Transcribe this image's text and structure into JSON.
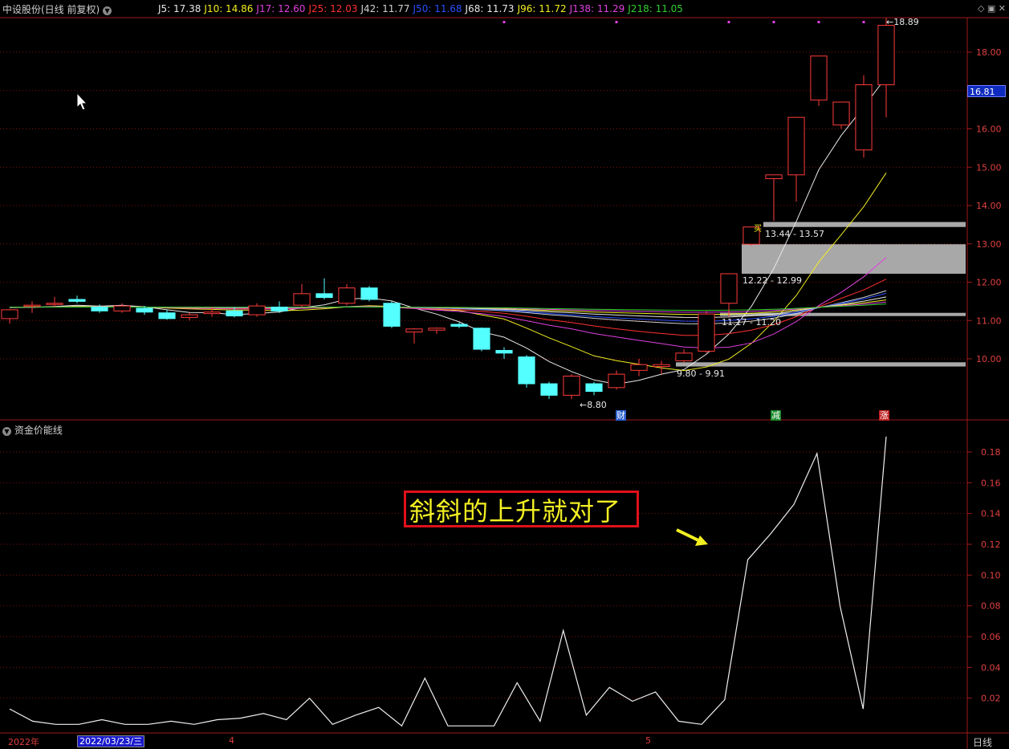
{
  "header": {
    "title": "中设股份(日线 前复权)",
    "ma_legend": [
      {
        "label": "J5: 17.38",
        "color": "#e8e8e8"
      },
      {
        "label": "J10: 14.86",
        "color": "#f2ef22"
      },
      {
        "label": "J17: 12.60",
        "color": "#e040e0"
      },
      {
        "label": "J25: 12.03",
        "color": "#ff3030"
      },
      {
        "label": "J42: 11.77",
        "color": "#d0d0d0"
      },
      {
        "label": "J50: 11.68",
        "color": "#2850ff"
      },
      {
        "label": "J68: 11.73",
        "color": "#e8e8e8"
      },
      {
        "label": "J96: 11.72",
        "color": "#f2ef22"
      },
      {
        "label": "J138: 11.29",
        "color": "#e040e0"
      },
      {
        "label": "J218: 11.05",
        "color": "#30d030"
      }
    ],
    "window_icons": "◇ ▣ ✕"
  },
  "price_axis": {
    "ticks": [
      "18.00",
      "17.00",
      "16.00",
      "15.00",
      "14.00",
      "13.00",
      "12.00",
      "11.00",
      "10.00"
    ],
    "current_price": "16.81"
  },
  "price_labels": {
    "high": "18.89",
    "low": "8.80",
    "zone1": "13.44 - 13.57",
    "zone2": "12.22 - 12.99",
    "zone3": "11.17 - 11.20",
    "zone4": "9.80 - 9.91",
    "buy_mark": "买"
  },
  "event_markers": [
    {
      "label": "财",
      "color": "#2a5fd0"
    },
    {
      "label": "减",
      "color": "#1a8a2a"
    },
    {
      "label": "涨",
      "color": "#c02020"
    }
  ],
  "subchart": {
    "title": "资金价能线",
    "ticks": [
      "0.18",
      "0.16",
      "0.14",
      "0.12",
      "0.10",
      "0.08",
      "0.06",
      "0.04",
      "0.02"
    ]
  },
  "annotation": {
    "text": "斜斜的上升就对了"
  },
  "date_axis": {
    "year": "2022年",
    "selected_date": "2022/03/23/三",
    "month_4": "4",
    "month_5": "5",
    "period": "日线"
  },
  "chart_data": [
    {
      "type": "candlestick",
      "title": "中设股份(日线 前复权)",
      "ylim": [
        8.6,
        19.2
      ],
      "candles": [
        {
          "o": 11.05,
          "h": 11.3,
          "l": 10.92,
          "c": 11.28
        },
        {
          "o": 11.4,
          "h": 11.5,
          "l": 11.2,
          "c": 11.4
        },
        {
          "o": 11.45,
          "h": 11.62,
          "l": 11.35,
          "c": 11.45
        },
        {
          "o": 11.55,
          "h": 11.65,
          "l": 11.45,
          "c": 11.5
        },
        {
          "o": 11.35,
          "h": 11.42,
          "l": 11.2,
          "c": 11.25
        },
        {
          "o": 11.25,
          "h": 11.45,
          "l": 11.2,
          "c": 11.38
        },
        {
          "o": 11.32,
          "h": 11.38,
          "l": 11.15,
          "c": 11.22
        },
        {
          "o": 11.2,
          "h": 11.28,
          "l": 11.02,
          "c": 11.05
        },
        {
          "o": 11.08,
          "h": 11.2,
          "l": 11.0,
          "c": 11.15
        },
        {
          "o": 11.18,
          "h": 11.35,
          "l": 11.1,
          "c": 11.22
        },
        {
          "o": 11.25,
          "h": 11.35,
          "l": 11.08,
          "c": 11.12
        },
        {
          "o": 11.15,
          "h": 11.45,
          "l": 11.1,
          "c": 11.38
        },
        {
          "o": 11.35,
          "h": 11.5,
          "l": 11.2,
          "c": 11.25
        },
        {
          "o": 11.4,
          "h": 11.95,
          "l": 11.35,
          "c": 11.7
        },
        {
          "o": 11.7,
          "h": 12.1,
          "l": 11.55,
          "c": 11.6
        },
        {
          "o": 11.45,
          "h": 11.95,
          "l": 11.4,
          "c": 11.85
        },
        {
          "o": 11.85,
          "h": 11.9,
          "l": 11.5,
          "c": 11.55
        },
        {
          "o": 11.45,
          "h": 11.5,
          "l": 10.8,
          "c": 10.85
        },
        {
          "o": 10.7,
          "h": 10.8,
          "l": 10.4,
          "c": 10.78
        },
        {
          "o": 10.75,
          "h": 10.82,
          "l": 10.65,
          "c": 10.8
        },
        {
          "o": 10.9,
          "h": 10.95,
          "l": 10.8,
          "c": 10.85
        },
        {
          "o": 10.8,
          "h": 10.82,
          "l": 10.2,
          "c": 10.25
        },
        {
          "o": 10.22,
          "h": 10.3,
          "l": 10.0,
          "c": 10.15
        },
        {
          "o": 10.05,
          "h": 10.1,
          "l": 9.25,
          "c": 9.35
        },
        {
          "o": 9.35,
          "h": 9.4,
          "l": 8.95,
          "c": 9.05
        },
        {
          "o": 9.05,
          "h": 9.6,
          "l": 8.95,
          "c": 9.55
        },
        {
          "o": 9.35,
          "h": 9.4,
          "l": 9.05,
          "c": 9.15
        },
        {
          "o": 9.25,
          "h": 9.7,
          "l": 9.2,
          "c": 9.6
        },
        {
          "o": 9.7,
          "h": 10.0,
          "l": 9.55,
          "c": 9.85
        },
        {
          "o": 9.8,
          "h": 9.95,
          "l": 9.6,
          "c": 9.85
        },
        {
          "o": 9.95,
          "h": 10.25,
          "l": 9.9,
          "c": 10.15
        },
        {
          "o": 10.2,
          "h": 11.25,
          "l": 10.15,
          "c": 11.17
        },
        {
          "o": 11.45,
          "h": 12.22,
          "l": 11.1,
          "c": 12.22
        },
        {
          "o": 12.99,
          "h": 13.44,
          "l": 12.95,
          "c": 13.44
        },
        {
          "o": 14.7,
          "h": 14.8,
          "l": 13.6,
          "c": 14.8
        },
        {
          "o": 14.8,
          "h": 16.3,
          "l": 14.1,
          "c": 16.3
        },
        {
          "o": 16.75,
          "h": 17.9,
          "l": 16.6,
          "c": 17.9
        },
        {
          "o": 16.1,
          "h": 16.7,
          "l": 16.0,
          "c": 16.7
        },
        {
          "o": 15.45,
          "h": 17.4,
          "l": 15.25,
          "c": 17.15
        },
        {
          "o": 17.15,
          "h": 18.89,
          "l": 16.3,
          "c": 18.7
        }
      ]
    },
    {
      "type": "line",
      "title": "资金价能线",
      "ylim": [
        0.0,
        0.19
      ],
      "values": [
        0.013,
        0.005,
        0.003,
        0.003,
        0.006,
        0.003,
        0.003,
        0.005,
        0.003,
        0.006,
        0.007,
        0.01,
        0.006,
        0.02,
        0.003,
        0.009,
        0.014,
        0.002,
        0.033,
        0.002,
        0.002,
        0.002,
        0.03,
        0.005,
        0.064,
        0.009,
        0.027,
        0.018,
        0.024,
        0.005,
        0.003,
        0.019,
        0.11,
        0.127,
        0.146,
        0.179,
        0.08,
        0.013,
        0.19
      ]
    }
  ]
}
